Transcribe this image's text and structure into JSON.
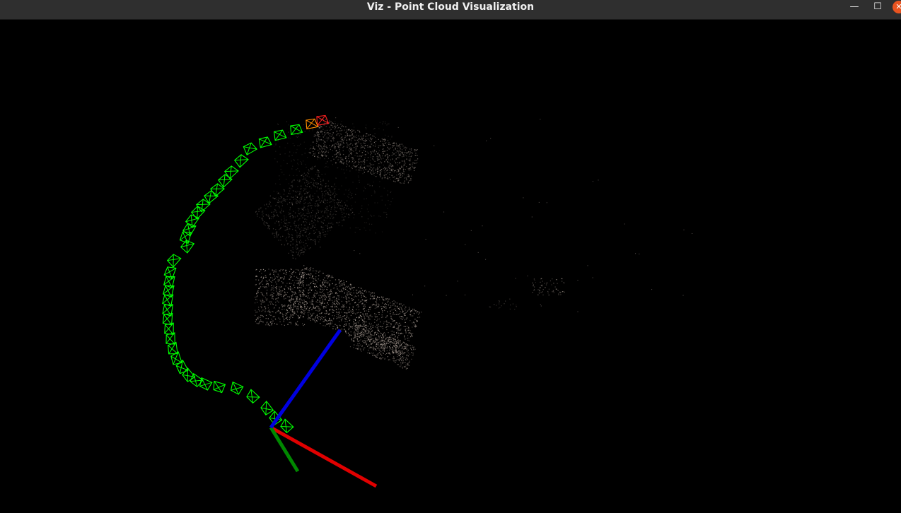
{
  "window": {
    "title": "Viz - Point Cloud Visualization",
    "minimize_glyph": "—",
    "maximize_glyph": "☐",
    "close_glyph": "✕"
  },
  "scene": {
    "background": "#000000",
    "trajectory_color": "#00ff00",
    "current_frame_color": "#ff8c00",
    "latest_frame_color": "#ff2020",
    "point_color": "#c8b8b0",
    "axes": {
      "x_color": "#e00000",
      "y_color": "#008800",
      "z_color": "#0000e0"
    }
  }
}
